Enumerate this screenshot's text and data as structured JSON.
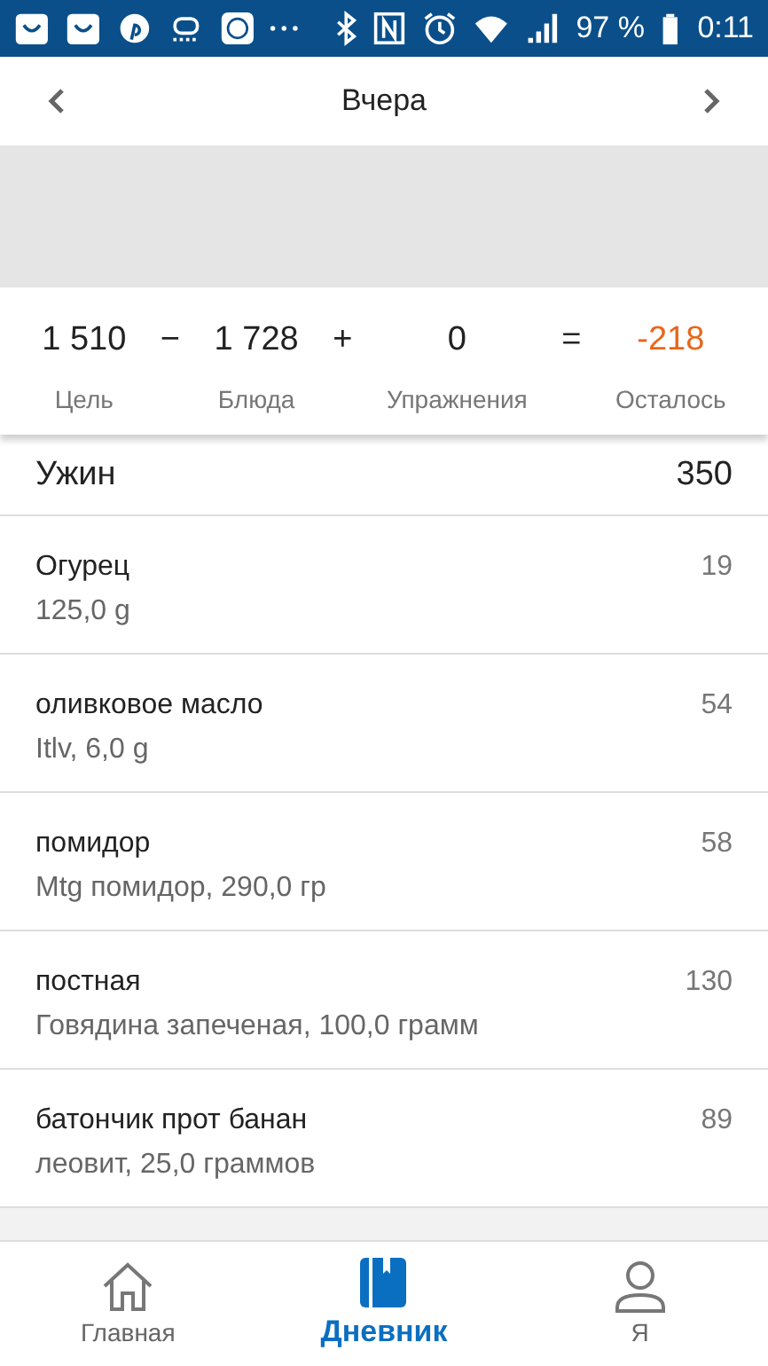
{
  "status_bar": {
    "battery": "97 %",
    "time": "0:11"
  },
  "header": {
    "title": "Вчера"
  },
  "summary": {
    "items": [
      {
        "value": "1 510",
        "label": "Цель",
        "highlight": false
      },
      {
        "operator": "−"
      },
      {
        "value": "1 728",
        "label": "Блюда",
        "highlight": false
      },
      {
        "operator": "+"
      },
      {
        "value": "0",
        "label": "Упражнения",
        "highlight": false
      },
      {
        "operator": "="
      },
      {
        "value": "-218",
        "label": "Осталось",
        "highlight": true
      }
    ]
  },
  "meal": {
    "name": "Ужин",
    "calories": "350"
  },
  "foods": [
    {
      "name": "Огурец",
      "detail": "125,0 g",
      "calories": "19"
    },
    {
      "name": "оливковое масло",
      "detail": "Itlv, 6,0 g",
      "calories": "54"
    },
    {
      "name": "помидор",
      "detail": "Mtg помидор, 290,0 гр",
      "calories": "58"
    },
    {
      "name": "постная",
      "detail": "Говядина запеченая, 100,0 грамм",
      "calories": "130"
    },
    {
      "name": "батончик прот банан",
      "detail": "леовит, 25,0 граммов",
      "calories": "89"
    }
  ],
  "nav": [
    {
      "label": "Главная",
      "kind": "home",
      "selected": false
    },
    {
      "label": "Дневник",
      "kind": "diary",
      "selected": true
    },
    {
      "label": "Я",
      "kind": "profile",
      "selected": false
    }
  ]
}
